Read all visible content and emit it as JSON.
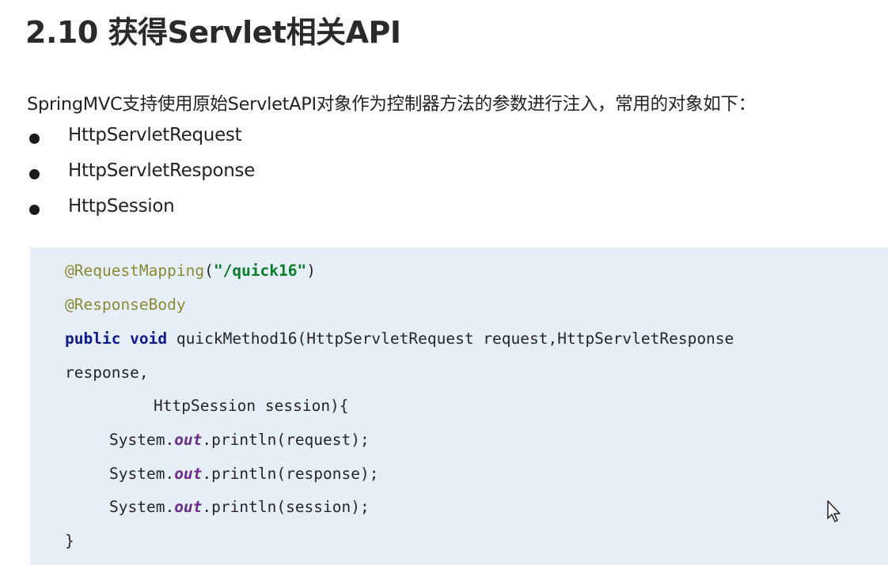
{
  "heading": "2.10 获得Servlet相关API",
  "intro_text": "SpringMVC支持使用原始ServletAPI对象作为控制器方法的参数进行注入，常用的对象如下：",
  "bullets": [
    "HttpServletRequest",
    "HttpServletResponse",
    "HttpSession"
  ],
  "code": {
    "line1": {
      "annotation": "@RequestMapping",
      "open": "(",
      "string": "\"/quick16\"",
      "close": ")"
    },
    "line2": {
      "annotation": "@ResponseBody"
    },
    "line3": {
      "keyword": "public void",
      "rest": " quickMethod16(HttpServletRequest request,HttpServletResponse"
    },
    "line4": "response,",
    "line5": "HttpSession session){",
    "line6": {
      "prefix": "System.",
      "field": "out",
      "suffix": ".println(request);"
    },
    "line7": {
      "prefix": "System.",
      "field": "out",
      "suffix": ".println(response);"
    },
    "line8": {
      "prefix": "System.",
      "field": "out",
      "suffix": ".println(session);"
    },
    "line9": "}"
  },
  "colors": {
    "code_background": "#e6eef8",
    "annotation": "#8a8a32",
    "string": "#0a7d2c",
    "keyword": "#101a8c",
    "static_field": "#6a2f8a"
  },
  "icons": {
    "cursor": "mouse-pointer-icon"
  }
}
